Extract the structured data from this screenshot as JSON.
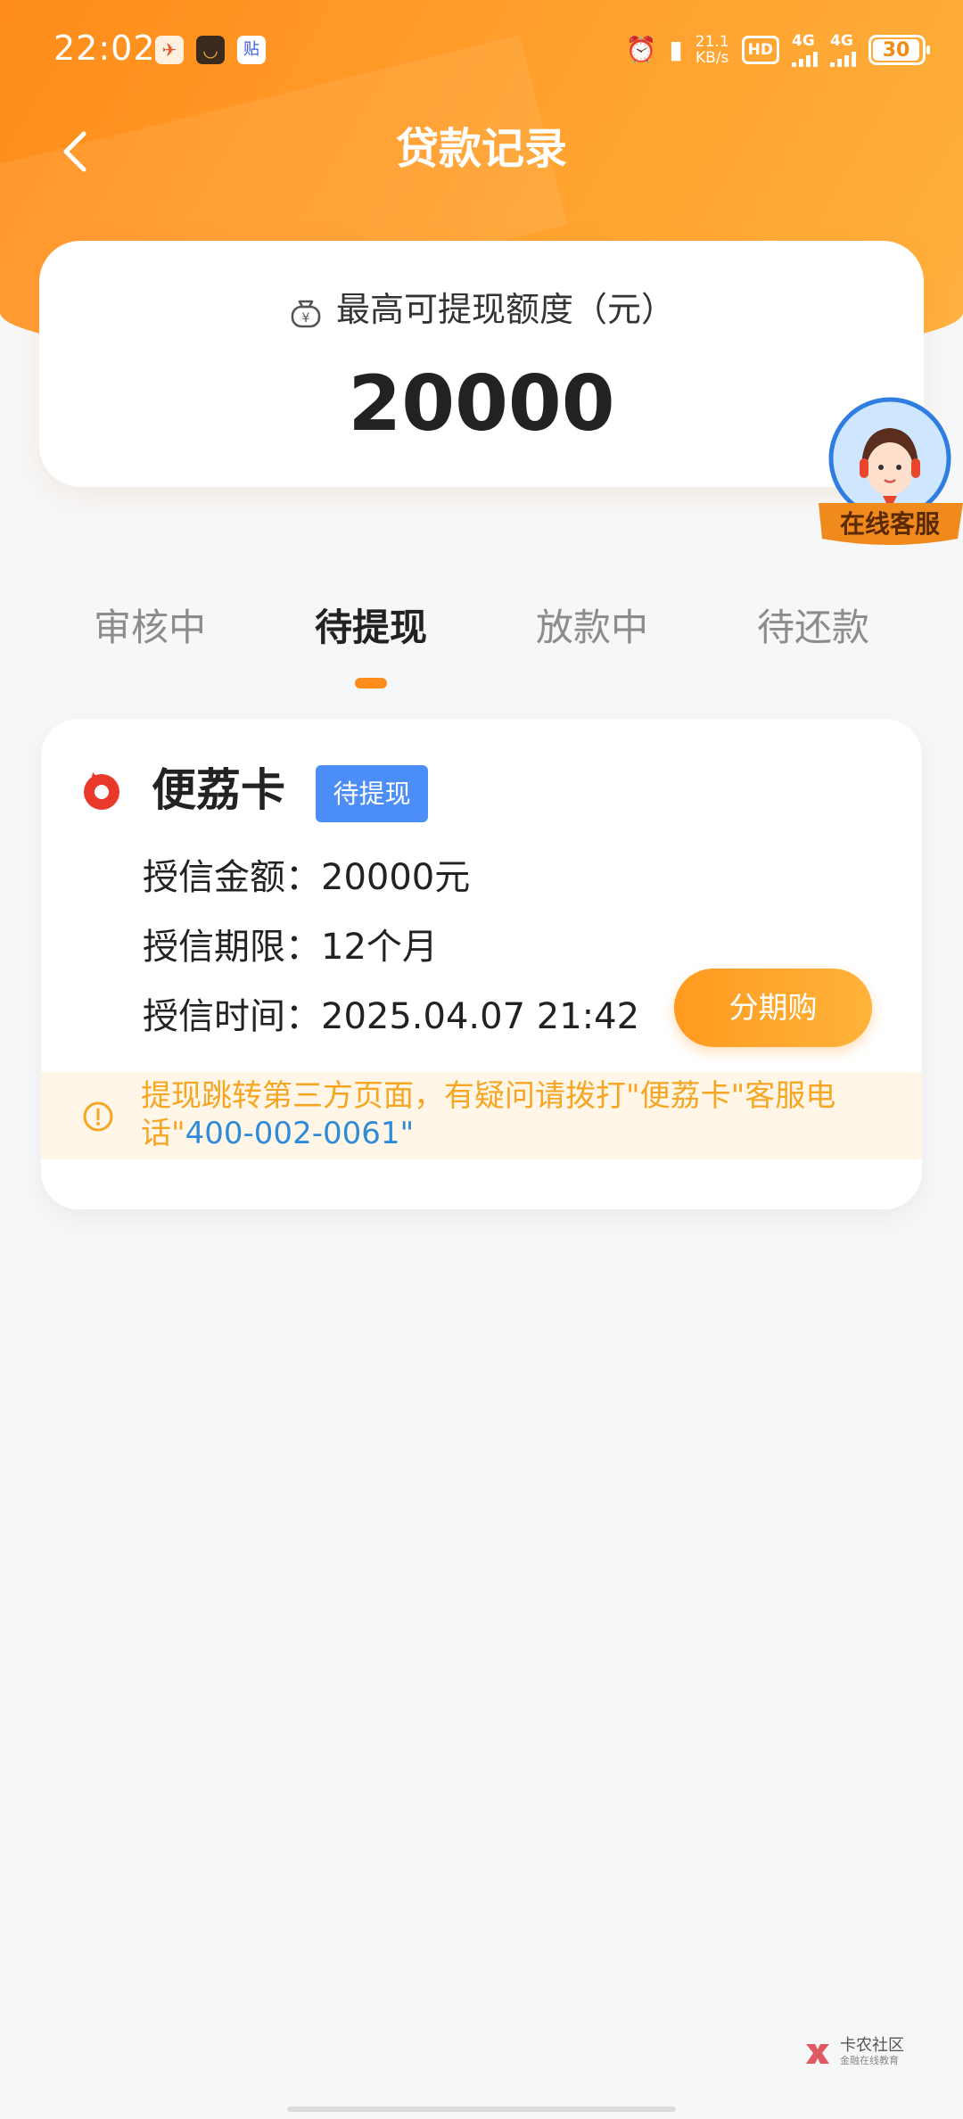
{
  "status_bar": {
    "time": "22:02",
    "net_speed_value": "21.1",
    "net_speed_unit": "KB/s",
    "hd": "HD",
    "sim1": "4G",
    "sim2": "4G",
    "battery": "30",
    "app_icon_3": "贴"
  },
  "nav": {
    "title": "贷款记录",
    "back_icon": "chevron-left-icon"
  },
  "amount_card": {
    "label": "最高可提现额度（元）",
    "value": "20000",
    "icon": "moneybag-yen-icon"
  },
  "customer_service": {
    "label": "在线客服"
  },
  "tabs": [
    {
      "label": "审核中",
      "active": false
    },
    {
      "label": "待提现",
      "active": true
    },
    {
      "label": "放款中",
      "active": false
    },
    {
      "label": "待还款",
      "active": false
    }
  ],
  "loan": {
    "brand": "便荔卡",
    "status_tag": "待提现",
    "rows": [
      {
        "label": "授信金额：",
        "value": "20000元"
      },
      {
        "label": "授信期限：",
        "value": "12个月"
      },
      {
        "label": "授信时间：",
        "value": "2025.04.07 21:42"
      }
    ],
    "button_label": "分期购",
    "notice_text": "提现跳转第三方页面，有疑问请拨打\"便荔卡\"客服电话\"",
    "notice_phone": "400-002-0061",
    "notice_end": "\"",
    "colors": {
      "accent": "#ff8b1a",
      "tag": "#4c8ef7",
      "notice_text": "#f5a623",
      "phone": "#2f8bd8"
    }
  },
  "watermark": {
    "title": "卡农社区",
    "subtitle": "金融在线教育"
  }
}
